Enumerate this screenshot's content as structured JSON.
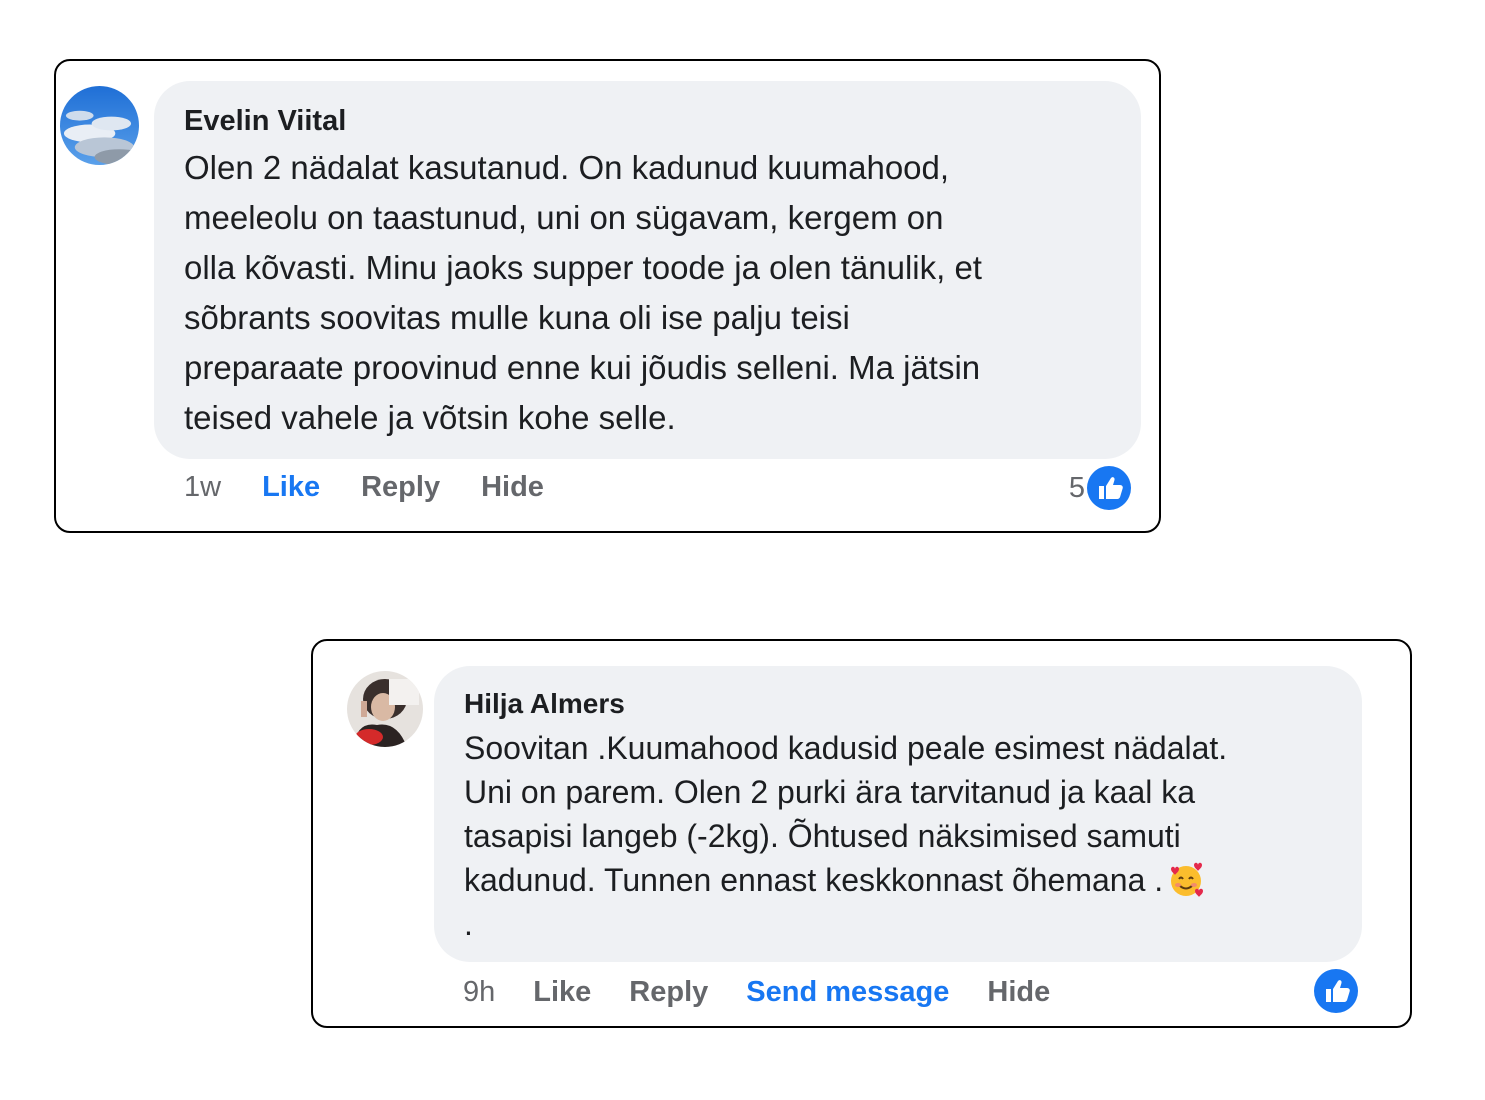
{
  "comments": [
    {
      "author": "Evelin Viital",
      "lines": [
        "Olen 2 nädalat kasutanud. On kadunud kuumahood,",
        "meeleolu on taastunud, uni on sügavam, kergem on",
        "olla kõvasti. Minu jaoks supper toode ja olen tänulik, et",
        "sõbrants soovitas mulle kuna oli ise palju teisi",
        "preparaate proovinud enne kui jõudis selleni. Ma jätsin",
        "teised vahele ja võtsin kohe selle."
      ],
      "time": "1w",
      "like_label": "Like",
      "reply_label": "Reply",
      "hide_label": "Hide",
      "reaction_count": "5",
      "reaction_icon": "thumbs-up-icon"
    },
    {
      "author": "Hilja Almers",
      "lines": [
        "Soovitan .Kuumahood kadusid peale esimest nädalat.",
        "Uni on parem. Olen 2 purki ära tarvitanud ja kaal ka",
        "tasapisi langeb (-2kg). Õhtused näksimised samuti",
        "kadunud. Tunnen ennast keskkonnast õhemana .",
        "."
      ],
      "emoji": "smiling-face-with-hearts-icon",
      "time": "9h",
      "like_label": "Like",
      "reply_label": "Reply",
      "send_message_label": "Send message",
      "hide_label": "Hide",
      "reaction_icon": "thumbs-up-icon"
    }
  ],
  "colors": {
    "bubble": "#eff1f4",
    "text": "#1c1e21",
    "muted": "#65676b",
    "accent": "#1877f2",
    "border": "#000000"
  }
}
